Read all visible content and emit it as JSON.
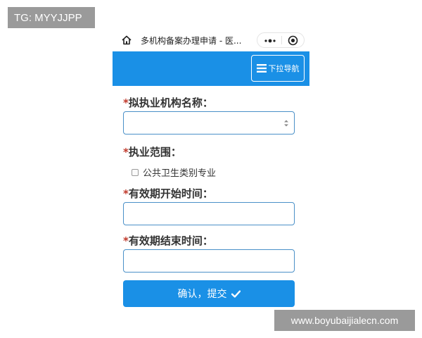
{
  "watermarks": {
    "top_left": "TG: MYYJJPP",
    "bottom_right": "www.boyubaijialecn.com"
  },
  "titlebar": {
    "title": "多机构备案办理申请 - 医...",
    "icons": [
      "home-icon",
      "more-icon",
      "target-icon"
    ]
  },
  "navbar": {
    "toggle_label": "下拉导航",
    "background": "#1a90e6"
  },
  "form": {
    "org_name": {
      "required_mark": "*",
      "label": "拟执业机构名称：",
      "value": ""
    },
    "scope": {
      "required_mark": "*",
      "label": "执业范围：",
      "options": [
        {
          "label": "公共卫生类别专业",
          "checked": false
        }
      ]
    },
    "start_time": {
      "required_mark": "*",
      "label": "有效期开始时间：",
      "value": ""
    },
    "end_time": {
      "required_mark": "*",
      "label": "有效期结束时间：",
      "value": ""
    },
    "submit_label": "确认，提交"
  },
  "colors": {
    "accent": "#1a90e6",
    "required": "#c0392b",
    "field_border": "#4a90c8"
  }
}
